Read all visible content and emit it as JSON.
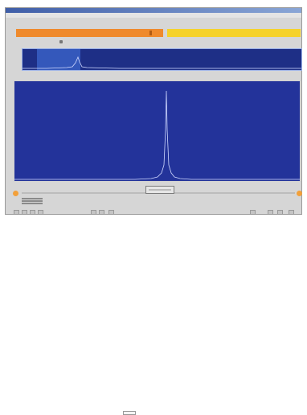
{
  "window": {
    "title": ""
  },
  "menu": [
    "",
    "",
    "",
    ""
  ],
  "panels": {
    "left_label": "",
    "right_label": "",
    "overview_label": "",
    "main_label": "",
    "peak_label": ""
  },
  "colors": {
    "left_bar": "#ef8a2c",
    "right_bar": "#f5d22a",
    "plot_background": "#23339a",
    "overview_background": "#1e2f86",
    "trace": "#cfd8ff",
    "scroll_handles": "#f2a03a"
  },
  "toolbar": {
    "icons": [
      "play-icon",
      "play-icon",
      "pan-icon",
      "zoom-icon",
      "print-icon",
      "copy-icon",
      "export-icon",
      "settings-icon",
      "zoom-in-icon",
      "zoom-out-icon",
      "help-icon"
    ]
  }
}
